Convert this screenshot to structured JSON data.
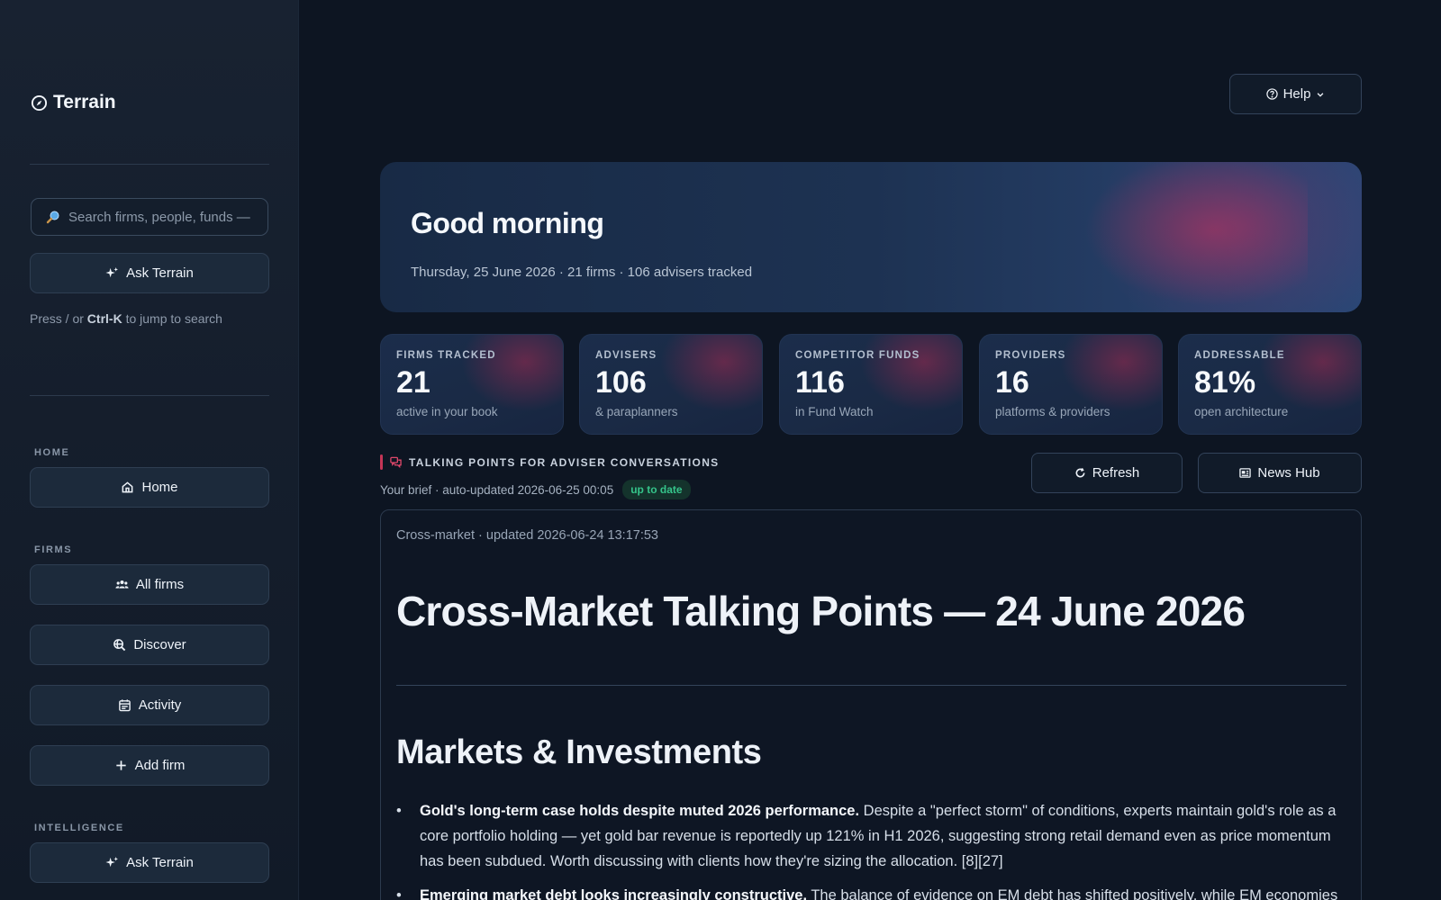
{
  "sidebar": {
    "brand": "Terrain",
    "search_placeholder": "Search firms, people, funds —",
    "ask_label": "Ask Terrain",
    "hint_pre": "Press / or ",
    "hint_key": "Ctrl-K",
    "hint_post": " to jump to search",
    "sections": {
      "home": "HOME",
      "firms": "FIRMS",
      "intelligence": "INTELLIGENCE"
    },
    "items": {
      "home": "Home",
      "all_firms": "All firms",
      "discover": "Discover",
      "activity": "Activity",
      "add_firm": "Add firm",
      "ask_terrain": "Ask Terrain"
    }
  },
  "header": {
    "help_label": "Help"
  },
  "hero": {
    "greeting": "Good morning",
    "subtitle": "Thursday, 25 June 2026 · 21 firms · 106 advisers tracked"
  },
  "stats": [
    {
      "label": "FIRMS TRACKED",
      "value": "21",
      "sub": "active in your book"
    },
    {
      "label": "ADVISERS",
      "value": "106",
      "sub": "& paraplanners"
    },
    {
      "label": "COMPETITOR FUNDS",
      "value": "116",
      "sub": "in Fund Watch"
    },
    {
      "label": "PROVIDERS",
      "value": "16",
      "sub": "platforms & providers"
    },
    {
      "label": "ADDRESSABLE",
      "value": "81%",
      "sub": "open architecture"
    }
  ],
  "talking_points": {
    "label": "TALKING POINTS FOR ADVISER CONVERSATIONS",
    "brief": "Your brief · auto-updated 2026-06-25 00:05",
    "badge": "up to date",
    "refresh_label": "Refresh",
    "news_label": "News Hub"
  },
  "article": {
    "meta": "Cross-market · updated 2026-06-24 13:17:53",
    "title": "Cross-Market Talking Points — 24 June 2026",
    "section": "Markets & Investments",
    "bullets": [
      {
        "lead": "Gold's long-term case holds despite muted 2026 performance.",
        "text": " Despite a \"perfect storm\" of conditions, experts maintain gold's role as a core portfolio holding — yet gold bar revenue is reportedly up 121% in H1 2026, suggesting strong retail demand even as price momentum has been subdued. Worth discussing with clients how they're sizing the allocation. [8][27]"
      },
      {
        "lead": "Emerging market debt looks increasingly constructive.",
        "text": " The balance of evidence on EM debt has shifted positively, while EM economies are"
      }
    ]
  },
  "colors": {
    "accent_red": "#c43556",
    "badge_green": "#35c48a",
    "background": "#0d1522"
  }
}
